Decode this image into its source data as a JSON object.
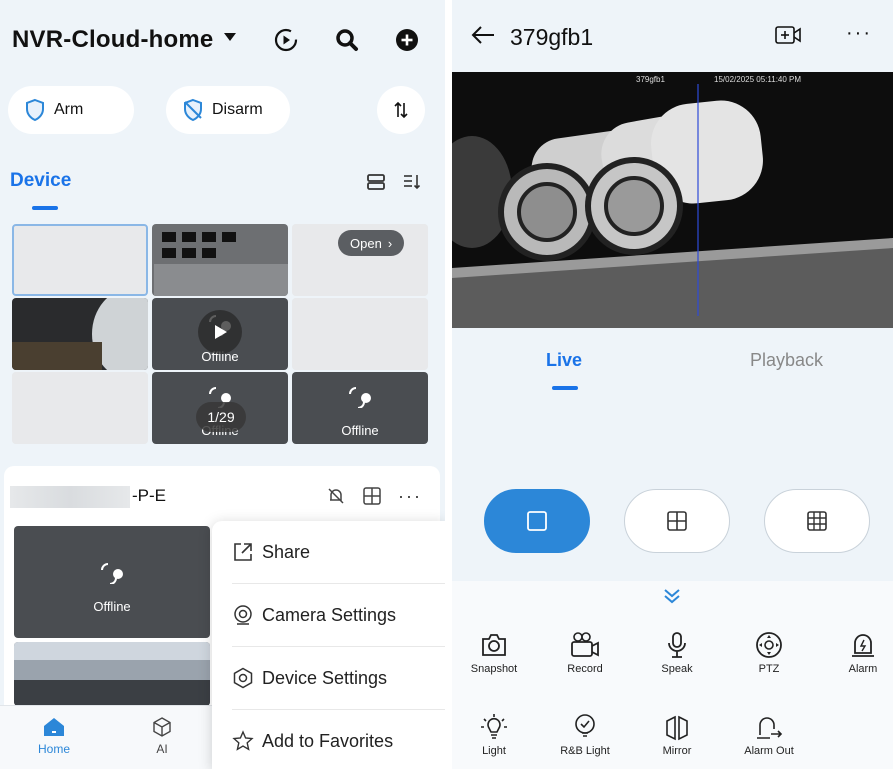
{
  "left": {
    "header": {
      "title": "NVR-Cloud-home",
      "icons": [
        "dropdown-caret-icon",
        "playback-icon",
        "search-icon",
        "add-icon"
      ]
    },
    "arm_label": "Arm",
    "disarm_label": "Disarm",
    "tab_device": "Device",
    "grid": {
      "open_label": "Open",
      "page_indicator": "1/29",
      "offline_labels": [
        "Offline",
        "Offline",
        "Offline"
      ]
    },
    "device2": {
      "name_suffix": "-P-E",
      "offline_label": "Offline"
    },
    "menu": {
      "items": [
        {
          "label": "Share",
          "icon": "share-icon"
        },
        {
          "label": "Camera Settings",
          "icon": "camera-settings-icon"
        },
        {
          "label": "Device Settings",
          "icon": "device-settings-icon"
        },
        {
          "label": "Add to Favorites",
          "icon": "star-icon"
        }
      ]
    },
    "tabbar": {
      "home": "Home",
      "ai": "AI"
    },
    "accent": "#1a73e8"
  },
  "right": {
    "title": "379gfb1",
    "osd_name": "379gfb1",
    "osd_time": "15/02/2025 05:11:40 PM",
    "tabs": {
      "live": "Live",
      "playback": "Playback"
    },
    "tools": {
      "row1": [
        "Snapshot",
        "Record",
        "Speak",
        "PTZ",
        "Alarm"
      ],
      "row2": [
        "Light",
        "R&B Light",
        "Mirror",
        "Alarm Out"
      ]
    },
    "active_layout": "single",
    "accent": "#2c87d8"
  }
}
